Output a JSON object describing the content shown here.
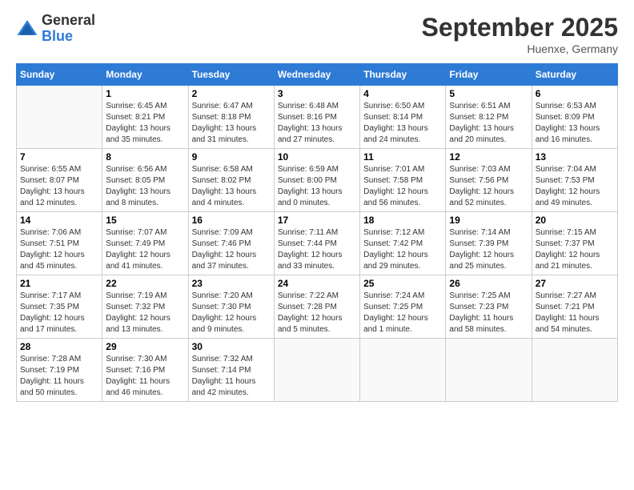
{
  "header": {
    "logo_general": "General",
    "logo_blue": "Blue",
    "month_title": "September 2025",
    "location": "Huenxe, Germany"
  },
  "days_of_week": [
    "Sunday",
    "Monday",
    "Tuesday",
    "Wednesday",
    "Thursday",
    "Friday",
    "Saturday"
  ],
  "weeks": [
    [
      {
        "day": "",
        "info": ""
      },
      {
        "day": "1",
        "info": "Sunrise: 6:45 AM\nSunset: 8:21 PM\nDaylight: 13 hours\nand 35 minutes."
      },
      {
        "day": "2",
        "info": "Sunrise: 6:47 AM\nSunset: 8:18 PM\nDaylight: 13 hours\nand 31 minutes."
      },
      {
        "day": "3",
        "info": "Sunrise: 6:48 AM\nSunset: 8:16 PM\nDaylight: 13 hours\nand 27 minutes."
      },
      {
        "day": "4",
        "info": "Sunrise: 6:50 AM\nSunset: 8:14 PM\nDaylight: 13 hours\nand 24 minutes."
      },
      {
        "day": "5",
        "info": "Sunrise: 6:51 AM\nSunset: 8:12 PM\nDaylight: 13 hours\nand 20 minutes."
      },
      {
        "day": "6",
        "info": "Sunrise: 6:53 AM\nSunset: 8:09 PM\nDaylight: 13 hours\nand 16 minutes."
      }
    ],
    [
      {
        "day": "7",
        "info": "Sunrise: 6:55 AM\nSunset: 8:07 PM\nDaylight: 13 hours\nand 12 minutes."
      },
      {
        "day": "8",
        "info": "Sunrise: 6:56 AM\nSunset: 8:05 PM\nDaylight: 13 hours\nand 8 minutes."
      },
      {
        "day": "9",
        "info": "Sunrise: 6:58 AM\nSunset: 8:02 PM\nDaylight: 13 hours\nand 4 minutes."
      },
      {
        "day": "10",
        "info": "Sunrise: 6:59 AM\nSunset: 8:00 PM\nDaylight: 13 hours\nand 0 minutes."
      },
      {
        "day": "11",
        "info": "Sunrise: 7:01 AM\nSunset: 7:58 PM\nDaylight: 12 hours\nand 56 minutes."
      },
      {
        "day": "12",
        "info": "Sunrise: 7:03 AM\nSunset: 7:56 PM\nDaylight: 12 hours\nand 52 minutes."
      },
      {
        "day": "13",
        "info": "Sunrise: 7:04 AM\nSunset: 7:53 PM\nDaylight: 12 hours\nand 49 minutes."
      }
    ],
    [
      {
        "day": "14",
        "info": "Sunrise: 7:06 AM\nSunset: 7:51 PM\nDaylight: 12 hours\nand 45 minutes."
      },
      {
        "day": "15",
        "info": "Sunrise: 7:07 AM\nSunset: 7:49 PM\nDaylight: 12 hours\nand 41 minutes."
      },
      {
        "day": "16",
        "info": "Sunrise: 7:09 AM\nSunset: 7:46 PM\nDaylight: 12 hours\nand 37 minutes."
      },
      {
        "day": "17",
        "info": "Sunrise: 7:11 AM\nSunset: 7:44 PM\nDaylight: 12 hours\nand 33 minutes."
      },
      {
        "day": "18",
        "info": "Sunrise: 7:12 AM\nSunset: 7:42 PM\nDaylight: 12 hours\nand 29 minutes."
      },
      {
        "day": "19",
        "info": "Sunrise: 7:14 AM\nSunset: 7:39 PM\nDaylight: 12 hours\nand 25 minutes."
      },
      {
        "day": "20",
        "info": "Sunrise: 7:15 AM\nSunset: 7:37 PM\nDaylight: 12 hours\nand 21 minutes."
      }
    ],
    [
      {
        "day": "21",
        "info": "Sunrise: 7:17 AM\nSunset: 7:35 PM\nDaylight: 12 hours\nand 17 minutes."
      },
      {
        "day": "22",
        "info": "Sunrise: 7:19 AM\nSunset: 7:32 PM\nDaylight: 12 hours\nand 13 minutes."
      },
      {
        "day": "23",
        "info": "Sunrise: 7:20 AM\nSunset: 7:30 PM\nDaylight: 12 hours\nand 9 minutes."
      },
      {
        "day": "24",
        "info": "Sunrise: 7:22 AM\nSunset: 7:28 PM\nDaylight: 12 hours\nand 5 minutes."
      },
      {
        "day": "25",
        "info": "Sunrise: 7:24 AM\nSunset: 7:25 PM\nDaylight: 12 hours\nand 1 minute."
      },
      {
        "day": "26",
        "info": "Sunrise: 7:25 AM\nSunset: 7:23 PM\nDaylight: 11 hours\nand 58 minutes."
      },
      {
        "day": "27",
        "info": "Sunrise: 7:27 AM\nSunset: 7:21 PM\nDaylight: 11 hours\nand 54 minutes."
      }
    ],
    [
      {
        "day": "28",
        "info": "Sunrise: 7:28 AM\nSunset: 7:19 PM\nDaylight: 11 hours\nand 50 minutes."
      },
      {
        "day": "29",
        "info": "Sunrise: 7:30 AM\nSunset: 7:16 PM\nDaylight: 11 hours\nand 46 minutes."
      },
      {
        "day": "30",
        "info": "Sunrise: 7:32 AM\nSunset: 7:14 PM\nDaylight: 11 hours\nand 42 minutes."
      },
      {
        "day": "",
        "info": ""
      },
      {
        "day": "",
        "info": ""
      },
      {
        "day": "",
        "info": ""
      },
      {
        "day": "",
        "info": ""
      }
    ]
  ]
}
